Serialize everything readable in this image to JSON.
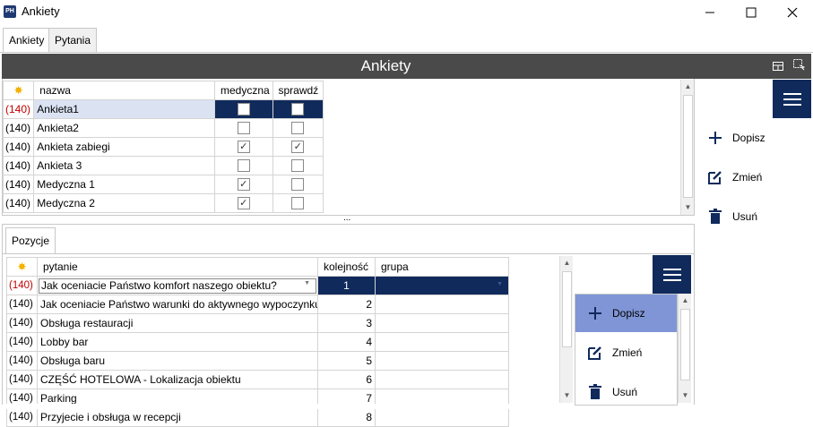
{
  "window": {
    "logo": "PH",
    "title": "Ankiety",
    "min_glyph": "—",
    "max_glyph": "☐",
    "close_glyph": "✕"
  },
  "tabs": [
    {
      "label": "Ankiety"
    },
    {
      "label": "Pytania"
    }
  ],
  "header": {
    "title": "Ankiety"
  },
  "top_grid": {
    "columns": [
      "nazwa",
      "medyczna",
      "sprawdź"
    ],
    "rows": [
      {
        "id": "(140)",
        "name": "Ankieta1",
        "medyczna": "",
        "sprawdz": ""
      },
      {
        "id": "(140)",
        "name": "Ankieta2",
        "medyczna": "",
        "sprawdz": ""
      },
      {
        "id": "(140)",
        "name": "Ankieta zabiegi",
        "medyczna": "✓",
        "sprawdz": "✓"
      },
      {
        "id": "(140)",
        "name": "Ankieta 3",
        "medyczna": "",
        "sprawdz": ""
      },
      {
        "id": "(140)",
        "name": "Medyczna 1",
        "medyczna": "✓",
        "sprawdz": ""
      },
      {
        "id": "(140)",
        "name": "Medyczna 2",
        "medyczna": "✓",
        "sprawdz": ""
      }
    ]
  },
  "right_actions": {
    "add": "Dopisz",
    "edit": "Zmień",
    "delete": "Usuń"
  },
  "splitter": "...",
  "lower": {
    "tab": "Pozycje",
    "columns": [
      "pytanie",
      "kolejność",
      "grupa"
    ],
    "rows": [
      {
        "id": "(140)",
        "q": "Jak oceniacie Państwo komfort naszego obiektu?",
        "order": "1",
        "group": ""
      },
      {
        "id": "(140)",
        "q": "Jak oceniacie Państwo warunki do aktywnego wypoczynku?",
        "order": "2",
        "group": ""
      },
      {
        "id": "(140)",
        "q": "Obsługa restauracji",
        "order": "3",
        "group": ""
      },
      {
        "id": "(140)",
        "q": "Lobby bar",
        "order": "4",
        "group": ""
      },
      {
        "id": "(140)",
        "q": "Obsługa baru",
        "order": "5",
        "group": ""
      },
      {
        "id": "(140)",
        "q": "CZĘŚĆ HOTELOWA - Lokalizacja obiektu",
        "order": "6",
        "group": ""
      },
      {
        "id": "(140)",
        "q": "Parking",
        "order": "7",
        "group": ""
      },
      {
        "id": "(140)",
        "q": "Przyjecie i obsługa w recepcji",
        "order": "8",
        "group": ""
      }
    ],
    "actions": {
      "add": "Dopisz",
      "edit": "Zmień",
      "delete": "Usuń"
    }
  },
  "colors": {
    "accent": "#102a5c",
    "header_bg": "#4a4a4a",
    "highlight": "#7f95d6",
    "id_red": "#c00000"
  }
}
